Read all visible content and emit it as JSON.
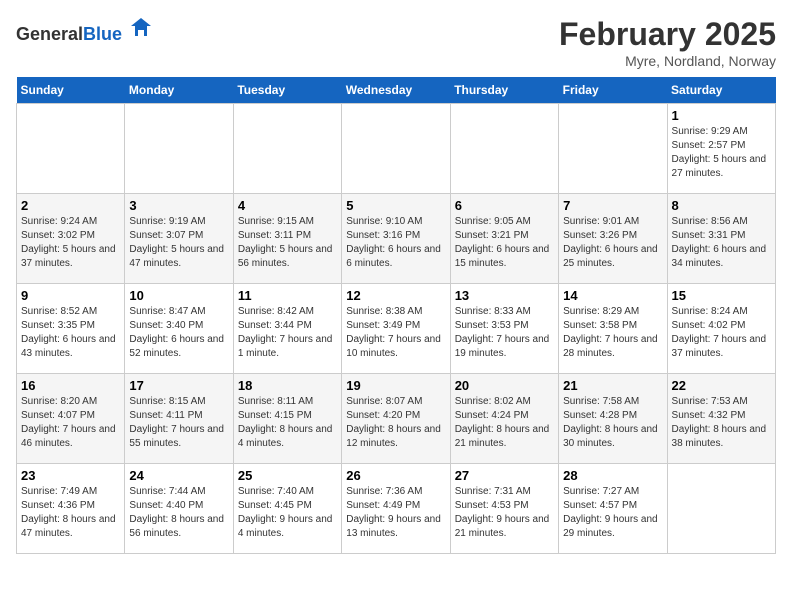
{
  "header": {
    "logo_general": "General",
    "logo_blue": "Blue",
    "title": "February 2025",
    "subtitle": "Myre, Nordland, Norway"
  },
  "calendar": {
    "weekdays": [
      "Sunday",
      "Monday",
      "Tuesday",
      "Wednesday",
      "Thursday",
      "Friday",
      "Saturday"
    ],
    "weeks": [
      [
        {
          "day": "",
          "detail": ""
        },
        {
          "day": "",
          "detail": ""
        },
        {
          "day": "",
          "detail": ""
        },
        {
          "day": "",
          "detail": ""
        },
        {
          "day": "",
          "detail": ""
        },
        {
          "day": "",
          "detail": ""
        },
        {
          "day": "1",
          "detail": "Sunrise: 9:29 AM\nSunset: 2:57 PM\nDaylight: 5 hours and 27 minutes."
        }
      ],
      [
        {
          "day": "2",
          "detail": "Sunrise: 9:24 AM\nSunset: 3:02 PM\nDaylight: 5 hours and 37 minutes."
        },
        {
          "day": "3",
          "detail": "Sunrise: 9:19 AM\nSunset: 3:07 PM\nDaylight: 5 hours and 47 minutes."
        },
        {
          "day": "4",
          "detail": "Sunrise: 9:15 AM\nSunset: 3:11 PM\nDaylight: 5 hours and 56 minutes."
        },
        {
          "day": "5",
          "detail": "Sunrise: 9:10 AM\nSunset: 3:16 PM\nDaylight: 6 hours and 6 minutes."
        },
        {
          "day": "6",
          "detail": "Sunrise: 9:05 AM\nSunset: 3:21 PM\nDaylight: 6 hours and 15 minutes."
        },
        {
          "day": "7",
          "detail": "Sunrise: 9:01 AM\nSunset: 3:26 PM\nDaylight: 6 hours and 25 minutes."
        },
        {
          "day": "8",
          "detail": "Sunrise: 8:56 AM\nSunset: 3:31 PM\nDaylight: 6 hours and 34 minutes."
        }
      ],
      [
        {
          "day": "9",
          "detail": "Sunrise: 8:52 AM\nSunset: 3:35 PM\nDaylight: 6 hours and 43 minutes."
        },
        {
          "day": "10",
          "detail": "Sunrise: 8:47 AM\nSunset: 3:40 PM\nDaylight: 6 hours and 52 minutes."
        },
        {
          "day": "11",
          "detail": "Sunrise: 8:42 AM\nSunset: 3:44 PM\nDaylight: 7 hours and 1 minute."
        },
        {
          "day": "12",
          "detail": "Sunrise: 8:38 AM\nSunset: 3:49 PM\nDaylight: 7 hours and 10 minutes."
        },
        {
          "day": "13",
          "detail": "Sunrise: 8:33 AM\nSunset: 3:53 PM\nDaylight: 7 hours and 19 minutes."
        },
        {
          "day": "14",
          "detail": "Sunrise: 8:29 AM\nSunset: 3:58 PM\nDaylight: 7 hours and 28 minutes."
        },
        {
          "day": "15",
          "detail": "Sunrise: 8:24 AM\nSunset: 4:02 PM\nDaylight: 7 hours and 37 minutes."
        }
      ],
      [
        {
          "day": "16",
          "detail": "Sunrise: 8:20 AM\nSunset: 4:07 PM\nDaylight: 7 hours and 46 minutes."
        },
        {
          "day": "17",
          "detail": "Sunrise: 8:15 AM\nSunset: 4:11 PM\nDaylight: 7 hours and 55 minutes."
        },
        {
          "day": "18",
          "detail": "Sunrise: 8:11 AM\nSunset: 4:15 PM\nDaylight: 8 hours and 4 minutes."
        },
        {
          "day": "19",
          "detail": "Sunrise: 8:07 AM\nSunset: 4:20 PM\nDaylight: 8 hours and 12 minutes."
        },
        {
          "day": "20",
          "detail": "Sunrise: 8:02 AM\nSunset: 4:24 PM\nDaylight: 8 hours and 21 minutes."
        },
        {
          "day": "21",
          "detail": "Sunrise: 7:58 AM\nSunset: 4:28 PM\nDaylight: 8 hours and 30 minutes."
        },
        {
          "day": "22",
          "detail": "Sunrise: 7:53 AM\nSunset: 4:32 PM\nDaylight: 8 hours and 38 minutes."
        }
      ],
      [
        {
          "day": "23",
          "detail": "Sunrise: 7:49 AM\nSunset: 4:36 PM\nDaylight: 8 hours and 47 minutes."
        },
        {
          "day": "24",
          "detail": "Sunrise: 7:44 AM\nSunset: 4:40 PM\nDaylight: 8 hours and 56 minutes."
        },
        {
          "day": "25",
          "detail": "Sunrise: 7:40 AM\nSunset: 4:45 PM\nDaylight: 9 hours and 4 minutes."
        },
        {
          "day": "26",
          "detail": "Sunrise: 7:36 AM\nSunset: 4:49 PM\nDaylight: 9 hours and 13 minutes."
        },
        {
          "day": "27",
          "detail": "Sunrise: 7:31 AM\nSunset: 4:53 PM\nDaylight: 9 hours and 21 minutes."
        },
        {
          "day": "28",
          "detail": "Sunrise: 7:27 AM\nSunset: 4:57 PM\nDaylight: 9 hours and 29 minutes."
        },
        {
          "day": "",
          "detail": ""
        }
      ]
    ]
  }
}
